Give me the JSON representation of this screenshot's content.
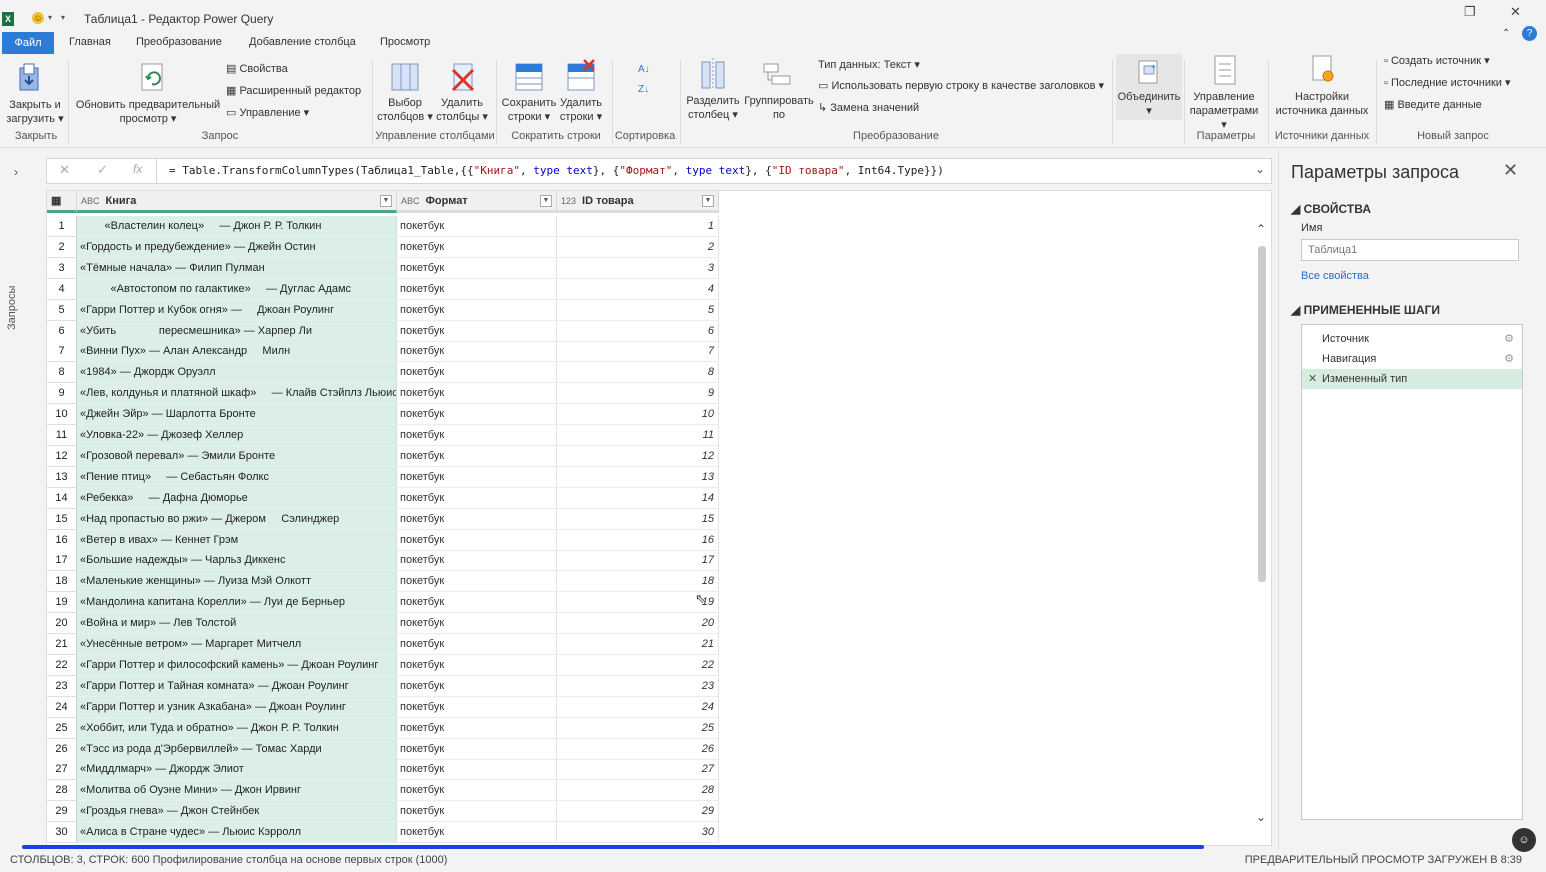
{
  "window": {
    "title": "Таблица1 - Редактор Power Query",
    "app_icon": "X"
  },
  "ribbon_tabs": [
    "Файл",
    "Главная",
    "Преобразование",
    "Добавление столбца",
    "Просмотр"
  ],
  "ribbon": {
    "close_load": [
      "Закрыть и",
      "загрузить"
    ],
    "refresh": [
      "Обновить предварительный",
      "просмотр"
    ],
    "properties": "Свойства",
    "advanced_editor": "Расширенный редактор",
    "manage": "Управление",
    "choose_cols": [
      "Выбор",
      "столбцов"
    ],
    "remove_cols": [
      "Удалить",
      "столбцы"
    ],
    "keep_rows": [
      "Сохранить",
      "строки"
    ],
    "remove_rows": [
      "Удалить",
      "строки"
    ],
    "split_col": [
      "Разделить",
      "столбец"
    ],
    "group_by": [
      "Группировать",
      "по"
    ],
    "data_type": "Тип данных: Текст",
    "first_row_headers": "Использовать первую строку в качестве заголовков",
    "replace_values": "Замена значений",
    "combine": "Объединить",
    "manage_params": [
      "Управление",
      "параметрами"
    ],
    "source_settings": [
      "Настройки",
      "источника данных"
    ],
    "new_source": "Создать источник",
    "recent_sources": "Последние источники",
    "enter_data": "Введите данные",
    "groups": {
      "close": "Закрыть",
      "query": "Запрос",
      "manage_cols": "Управление столбцами",
      "reduce_rows": "Сократить строки",
      "sort": "Сортировка",
      "transform": "Преобразование",
      "params": "Параметры",
      "data_sources": "Источники данных",
      "new_query": "Новый запрос"
    }
  },
  "queries_pane_label": "Запросы",
  "formula": {
    "prefix": "= Table.TransformColumnTypes(Таблица1_Table,{{",
    "s1": "\"Книга\"",
    "m1": ", ",
    "k1": "type text",
    "m2": "}, {",
    "s2": "\"Формат\"",
    "m3": ", ",
    "k2": "type text",
    "m4": "}, {",
    "s3": "\"ID товара\"",
    "suffix": ", Int64.Type}})"
  },
  "columns": [
    {
      "name": "Книга",
      "type_label": "ABC"
    },
    {
      "name": "Формат",
      "type_label": "ABC"
    },
    {
      "name": "ID товара",
      "type_label": "123"
    }
  ],
  "rows": [
    {
      "n": "1",
      "book": "        «Властелин колец»     — Джон Р. Р. Толкин",
      "format": "покетбук",
      "id": "1"
    },
    {
      "n": "2",
      "book": "«Гордость и предубеждение» — Джейн Остин",
      "format": "покетбук",
      "id": "2"
    },
    {
      "n": "3",
      "book": "«Тёмные начала» — Филип Пулман",
      "format": "покетбук",
      "id": "3"
    },
    {
      "n": "4",
      "book": "          «Автостопом по галактике»     — Дуглас Адамс",
      "format": "покетбук",
      "id": "4"
    },
    {
      "n": "5",
      "book": "«Гарри Поттер и Кубок огня» —     Джоан Роулинг",
      "format": "покетбук",
      "id": "5"
    },
    {
      "n": "6",
      "book": "«Убить              пересмешника» — Харпер Ли",
      "format": "покетбук",
      "id": "6"
    },
    {
      "n": "7",
      "book": "«Винни Пух» — Алан Александр     Милн",
      "format": "покетбук",
      "id": "7"
    },
    {
      "n": "8",
      "book": "«1984» — Джордж Оруэлл",
      "format": "покетбук",
      "id": "8"
    },
    {
      "n": "9",
      "book": "«Лев, колдунья и платяной шкаф»     — Клайв Стэйплз Льюис",
      "format": "покетбук",
      "id": "9"
    },
    {
      "n": "10",
      "book": "«Джейн Эйр» — Шарлотта Бронте",
      "format": "покетбук",
      "id": "10"
    },
    {
      "n": "11",
      "book": "«Уловка-22» — Джозеф Хеллер",
      "format": "покетбук",
      "id": "11"
    },
    {
      "n": "12",
      "book": "«Грозовой перевал» — Эмили Бронте",
      "format": "покетбук",
      "id": "12"
    },
    {
      "n": "13",
      "book": "«Пение птиц»     — Себастьян Фолкс",
      "format": "покетбук",
      "id": "13"
    },
    {
      "n": "14",
      "book": "«Ребекка»     — Дафна Дюморье",
      "format": "покетбук",
      "id": "14"
    },
    {
      "n": "15",
      "book": "«Над пропастью во ржи» — Джером     Сэлинджер",
      "format": "покетбук",
      "id": "15"
    },
    {
      "n": "16",
      "book": "«Ветер в ивах» — Кеннет Грэм",
      "format": "покетбук",
      "id": "16"
    },
    {
      "n": "17",
      "book": "«Большие надежды» — Чарльз Диккенс",
      "format": "покетбук",
      "id": "17"
    },
    {
      "n": "18",
      "book": "«Маленькие женщины» — Луиза Мэй Олкотт",
      "format": "покетбук",
      "id": "18"
    },
    {
      "n": "19",
      "book": "«Мандолина капитана Корелли» — Луи де Берньер",
      "format": "покетбук",
      "id": "19"
    },
    {
      "n": "20",
      "book": "«Война и мир» — Лев Толстой",
      "format": "покетбук",
      "id": "20"
    },
    {
      "n": "21",
      "book": "«Унесённые ветром» — Маргарет Митчелл",
      "format": "покетбук",
      "id": "21"
    },
    {
      "n": "22",
      "book": "«Гарри Поттер и философский камень» — Джоан Роулинг",
      "format": "покетбук",
      "id": "22"
    },
    {
      "n": "23",
      "book": "«Гарри Поттер и Тайная комната» — Джоан Роулинг",
      "format": "покетбук",
      "id": "23"
    },
    {
      "n": "24",
      "book": "«Гарри Поттер и узник Азкабана» — Джоан Роулинг",
      "format": "покетбук",
      "id": "24"
    },
    {
      "n": "25",
      "book": "«Хоббит, или Туда и обратно» — Джон Р. Р. Толкин",
      "format": "покетбук",
      "id": "25"
    },
    {
      "n": "26",
      "book": "«Тэсс из рода д'Эрбервиллей» — Томас Харди",
      "format": "покетбук",
      "id": "26"
    },
    {
      "n": "27",
      "book": "«Миддлмарч» — Джордж Элиот",
      "format": "покетбук",
      "id": "27"
    },
    {
      "n": "28",
      "book": "«Молитва об Оуэне Мини» — Джон Ирвинг",
      "format": "покетбук",
      "id": "28"
    },
    {
      "n": "29",
      "book": "«Гроздья гнева» — Джон Стейнбек",
      "format": "покетбук",
      "id": "29"
    },
    {
      "n": "30",
      "book": "«Алиса в Стране чудес» — Льюис Кэрролл",
      "format": "покетбук",
      "id": "30"
    }
  ],
  "panel": {
    "title": "Параметры запроса",
    "properties_section": "СВОЙСТВА",
    "name_label": "Имя",
    "name_value": "Таблица1",
    "all_properties": "Все свойства",
    "steps_section": "ПРИМЕНЕННЫЕ ШАГИ",
    "steps": [
      "Источник",
      "Навигация",
      "Измененный тип"
    ],
    "active_step": "Измененный тип"
  },
  "status": {
    "left": "СТОЛБЦОВ: 3, СТРОК: 600     Профилирование столбца на основе первых строк (1000)",
    "right": "ПРЕДВАРИТЕЛЬНЫЙ ПРОСМОТР ЗАГРУЖЕН В 8:39"
  },
  "colors": {
    "accent": "#2c7bd6",
    "column_highlight": "#dcefe6",
    "header_underline": "#4aa78a",
    "progress": "#1f3fe0"
  },
  "icons": [
    "excel-icon",
    "smiley-icon",
    "close-load-icon",
    "refresh-icon",
    "choose-columns-icon",
    "remove-columns-icon",
    "keep-rows-icon",
    "remove-rows-icon",
    "sort-icon",
    "split-column-icon",
    "group-by-icon",
    "combine-icon",
    "manage-params-icon",
    "source-settings-icon"
  ]
}
